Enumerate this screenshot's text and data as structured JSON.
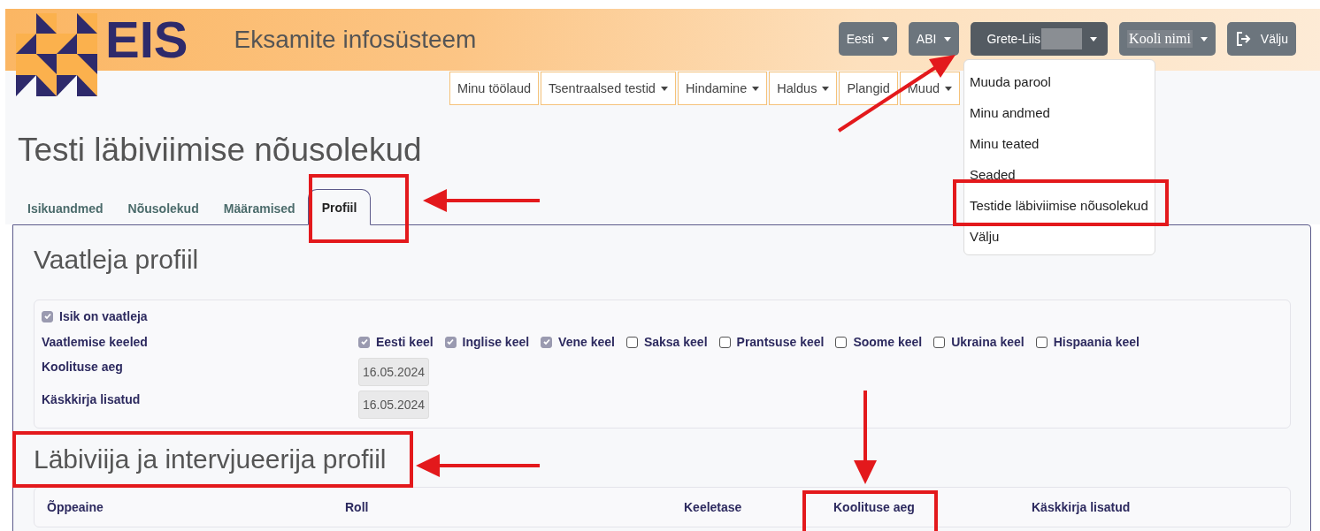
{
  "header": {
    "logo_text": "EIS",
    "title": "Eksamite infosüsteem",
    "buttons": [
      {
        "kind": "dropdown",
        "label": "Eesti",
        "expanded": false
      },
      {
        "kind": "dropdown",
        "label": "ABI",
        "expanded": false
      },
      {
        "kind": "user",
        "label": "Grete-Liis",
        "expanded": true
      },
      {
        "kind": "school",
        "label": "Kooli nimi",
        "expanded": false
      },
      {
        "kind": "logout",
        "label": "Välju",
        "expanded": false
      }
    ]
  },
  "nav": [
    {
      "label": "Minu töölaud",
      "dropdown": false
    },
    {
      "label": "Tsentraalsed testid",
      "dropdown": true
    },
    {
      "label": "Hindamine",
      "dropdown": true
    },
    {
      "label": "Haldus",
      "dropdown": true
    },
    {
      "label": "Plangid",
      "dropdown": false
    },
    {
      "label": "Muud",
      "dropdown": true
    }
  ],
  "user_menu": [
    "Muuda parool",
    "Minu andmed",
    "Minu teated",
    "Seaded",
    "Testide läbiviimise nõusolekud",
    "Välju"
  ],
  "page_title": "Testi läbiviimise nõusolekud",
  "tabs": [
    {
      "label": "Isikuandmed",
      "selected": false
    },
    {
      "label": "Nõusolekud",
      "selected": false
    },
    {
      "label": "Määramised",
      "selected": false
    },
    {
      "label": "Profiil",
      "selected": true
    }
  ],
  "observer": {
    "title": "Vaatleja profiil",
    "is_observer": {
      "label": "Isik on vaatleja",
      "checked": true
    },
    "languages": {
      "label": "Vaatlemise keeled",
      "options": [
        {
          "label": "Eesti keel",
          "checked": true
        },
        {
          "label": "Inglise keel",
          "checked": true
        },
        {
          "label": "Vene keel",
          "checked": true
        },
        {
          "label": "Saksa keel",
          "checked": false
        },
        {
          "label": "Prantsuse keel",
          "checked": false
        },
        {
          "label": "Soome keel",
          "checked": false
        },
        {
          "label": "Ukraina keel",
          "checked": false
        },
        {
          "label": "Hispaania keel",
          "checked": false
        }
      ]
    },
    "fields": [
      {
        "label": "Koolituse aeg",
        "value": "16.05.2024"
      },
      {
        "label": "Käskkirja lisatud",
        "value": "16.05.2024"
      }
    ]
  },
  "conductor": {
    "title": "Läbiviija ja intervjueerija profiil",
    "columns": [
      "Õppeaine",
      "Roll",
      "Keeletase",
      "Koolituse aeg",
      "Käskkirja lisatud"
    ]
  }
}
